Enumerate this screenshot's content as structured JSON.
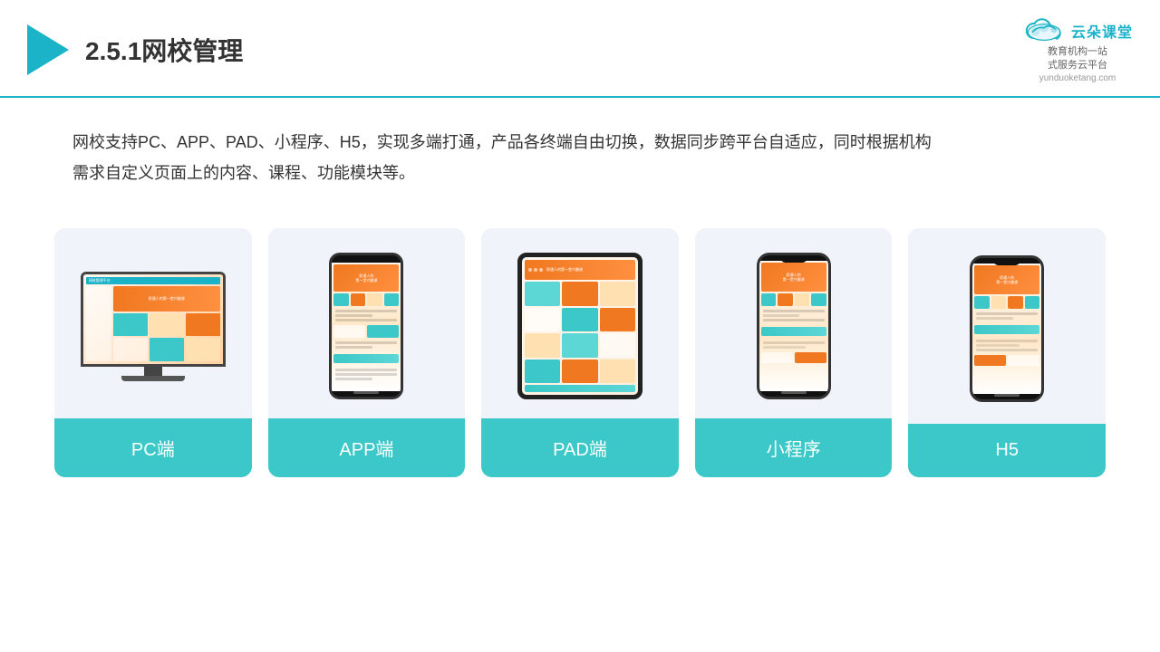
{
  "header": {
    "title": "2.5.1网校管理",
    "brand": {
      "name": "云朵课堂",
      "url": "yunduoketang.com",
      "tagline": "教育机构一站\n式服务云平台"
    }
  },
  "description": "网校支持PC、APP、PAD、小程序、H5，实现多端打通，产品各终端自由切换，数据同步跨平台自适应，同时根据机构\n需求自定义页面上的内容、课程、功能模块等。",
  "cards": [
    {
      "id": "pc",
      "label": "PC端"
    },
    {
      "id": "app",
      "label": "APP端"
    },
    {
      "id": "pad",
      "label": "PAD端"
    },
    {
      "id": "miniprogram",
      "label": "小程序"
    },
    {
      "id": "h5",
      "label": "H5"
    }
  ],
  "colors": {
    "accent": "#3cc8c8",
    "orange": "#f07820",
    "dark": "#333"
  }
}
